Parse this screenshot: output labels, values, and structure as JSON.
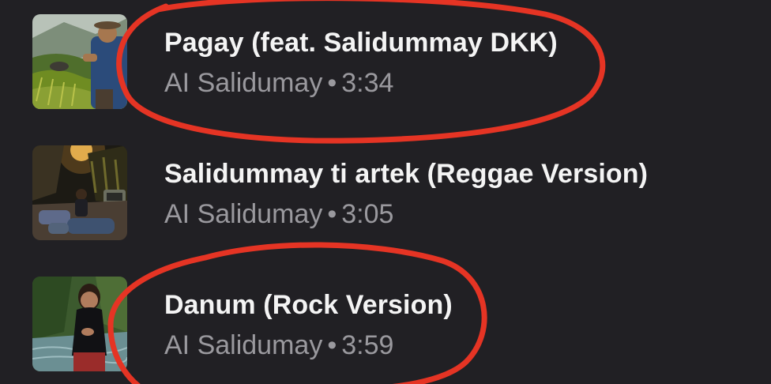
{
  "tracks": [
    {
      "title": "Pagay (feat. Salidummay DKK)",
      "artist": "AI Salidumay",
      "separator": "•",
      "duration": "3:34",
      "thumbnail_icon": "rice-terrace-farmer-thumbnail"
    },
    {
      "title": "Salidummay ti artek (Reggae Version)",
      "artist": "AI Salidumay",
      "separator": "•",
      "duration": "3:05",
      "thumbnail_icon": "night-street-band-thumbnail"
    },
    {
      "title": "Danum (Rock Version)",
      "artist": "AI Salidumay",
      "separator": "•",
      "duration": "3:59",
      "thumbnail_icon": "river-singer-thumbnail"
    }
  ],
  "colors": {
    "background": "#212024",
    "title_text": "#f4f4f4",
    "subtitle_text": "#9a999e",
    "annotation_circle": "#e53424"
  }
}
